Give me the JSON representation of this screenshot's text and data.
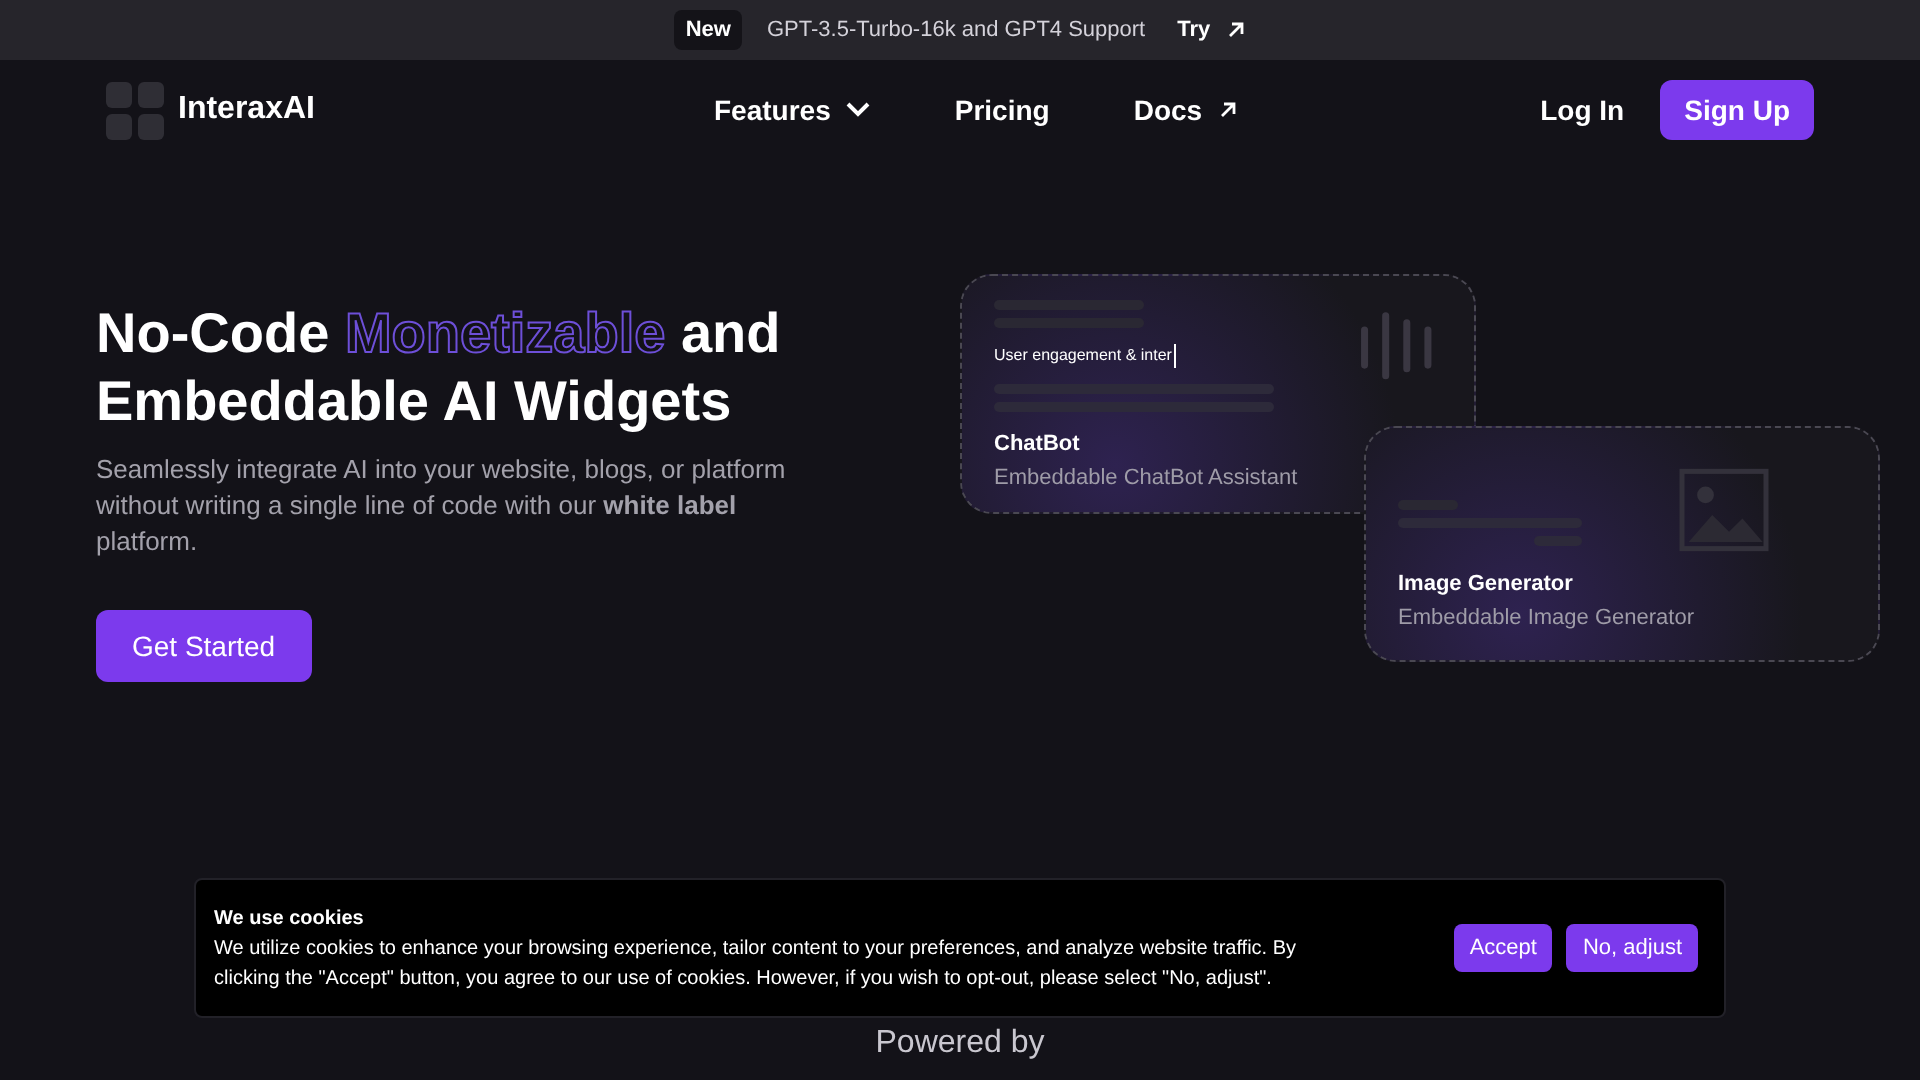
{
  "announcement": {
    "badge": "New",
    "text": "GPT-3.5-Turbo-16k and GPT4 Support",
    "link": "Try"
  },
  "nav": {
    "brand": "InteraxAI",
    "links": [
      {
        "label": "Features",
        "kind": "dropdown"
      },
      {
        "label": "Pricing",
        "kind": "plain"
      },
      {
        "label": "Docs",
        "kind": "external"
      }
    ],
    "login": "Log In",
    "signup": "Sign Up"
  },
  "hero": {
    "title_before": "No-Code",
    "title_highlight": "Monetizable",
    "title_after": "and",
    "title_line2": "Embeddable AI Widgets",
    "description": "Seamlessly integrate AI into your website, blogs, or platform without writing a single line of code with our **white label** platform.",
    "cta": "Get Started"
  },
  "widgets": [
    {
      "kind": "chatbot",
      "preview_text": "User engagement & inter",
      "title": "ChatBot",
      "subtitle": "Embeddable ChatBot Assistant"
    },
    {
      "kind": "image",
      "title": "Image Generator",
      "subtitle": "Embeddable Image Generator"
    }
  ],
  "powered_by": "Powered by",
  "cookie_banner": {
    "title": "We use cookies",
    "text": "We utilize cookies to enhance your browsing experience, tailor content to your preferences, and analyze website traffic. By clicking the \"Accept\" button, you agree to our use of cookies. However, if you wish to opt-out, please select \"No, adjust\".",
    "buttons": [
      "Accept",
      "No, adjust"
    ]
  }
}
